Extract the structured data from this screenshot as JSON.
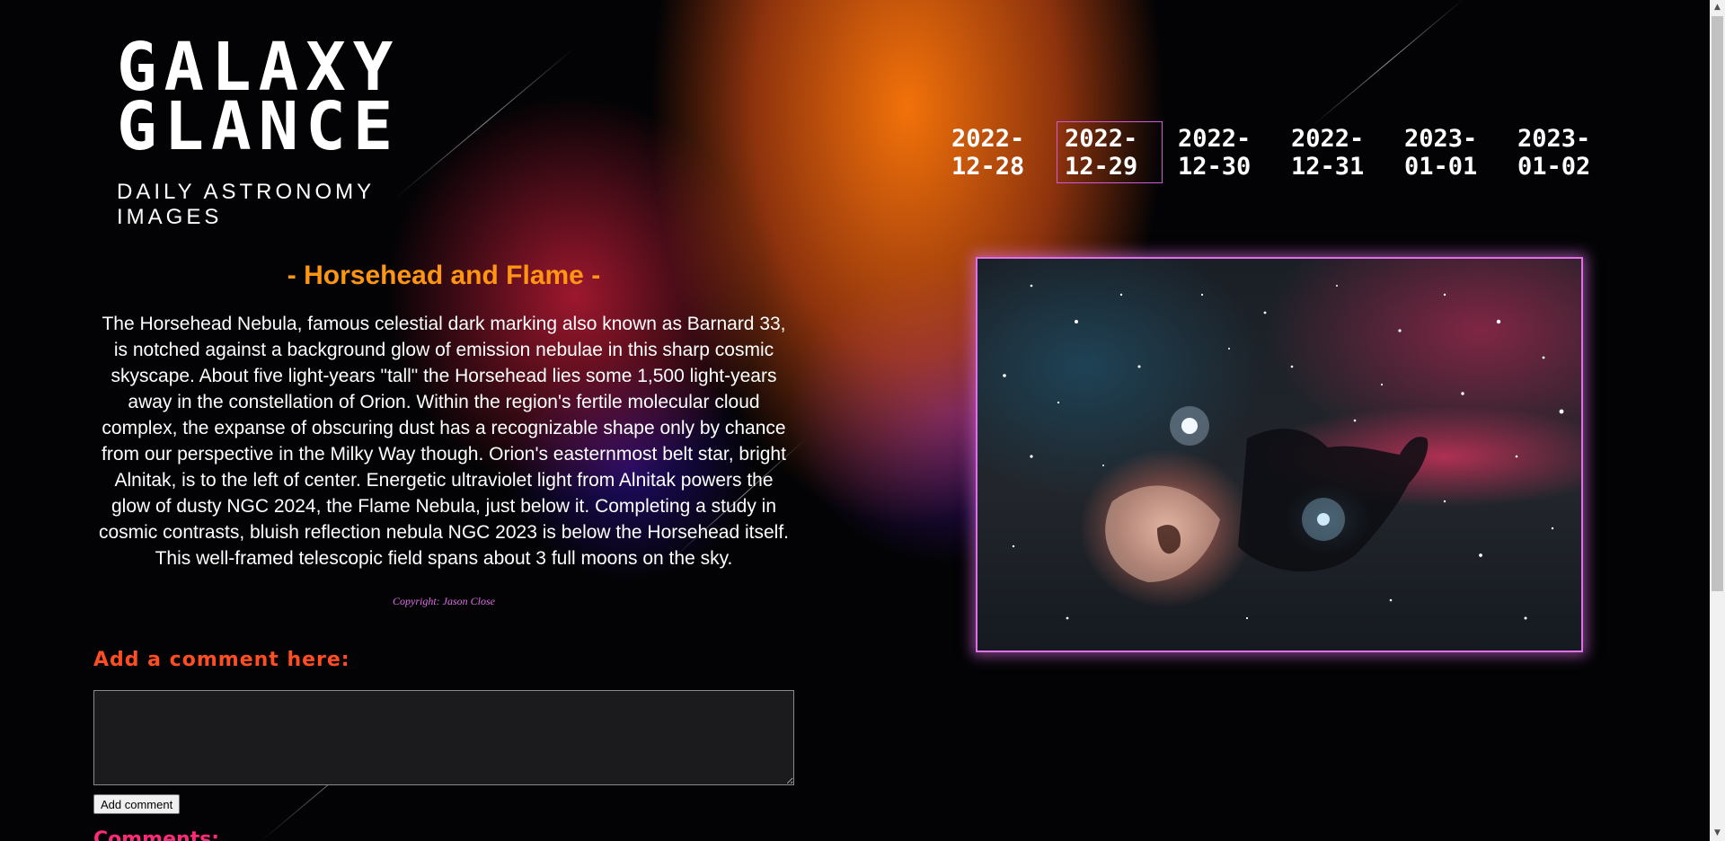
{
  "logo": {
    "title_line1": "GALAXY",
    "title_line2": "GLANCE",
    "subtitle": "DAILY ASTRONOMY IMAGES"
  },
  "date_nav": {
    "items": [
      {
        "label": "2022-\n12-28",
        "active": false
      },
      {
        "label": "2022-\n12-29",
        "active": true
      },
      {
        "label": "2022-\n12-30",
        "active": false
      },
      {
        "label": "2022-\n12-31",
        "active": false
      },
      {
        "label": "2023-\n01-01",
        "active": false
      },
      {
        "label": "2023-\n01-02",
        "active": false
      }
    ]
  },
  "article": {
    "title": "- Horsehead and Flame -",
    "body": "The Horsehead Nebula, famous celestial dark marking also known as Barnard 33, is notched against a background glow of emission nebulae in this sharp cosmic skyscape. About five light-years \"tall\" the Horsehead lies some 1,500 light-years away in the constellation of Orion. Within the region's fertile molecular cloud complex, the expanse of obscuring dust has a recognizable shape only by chance from our perspective in the Milky Way though. Orion's easternmost belt star, bright Alnitak, is to the left of center. Energetic ultraviolet light from Alnitak powers the glow of dusty NGC 2024, the Flame Nebula, just below it. Completing a study in cosmic contrasts, bluish reflection nebula NGC 2023 is below the Horsehead itself. This well-framed telescopic field spans about 3 full moons on the sky.",
    "copyright": "Copyright: Jason Close"
  },
  "comments": {
    "heading": "Add a comment here:",
    "textarea_value": "",
    "button_label": "Add comment",
    "list_heading": "Comments:"
  },
  "colors": {
    "accent_orange": "#ff9512",
    "accent_pink": "#e070e8",
    "comment_heading": "#ff4d24",
    "comments_list_heading": "#ff2a78"
  }
}
